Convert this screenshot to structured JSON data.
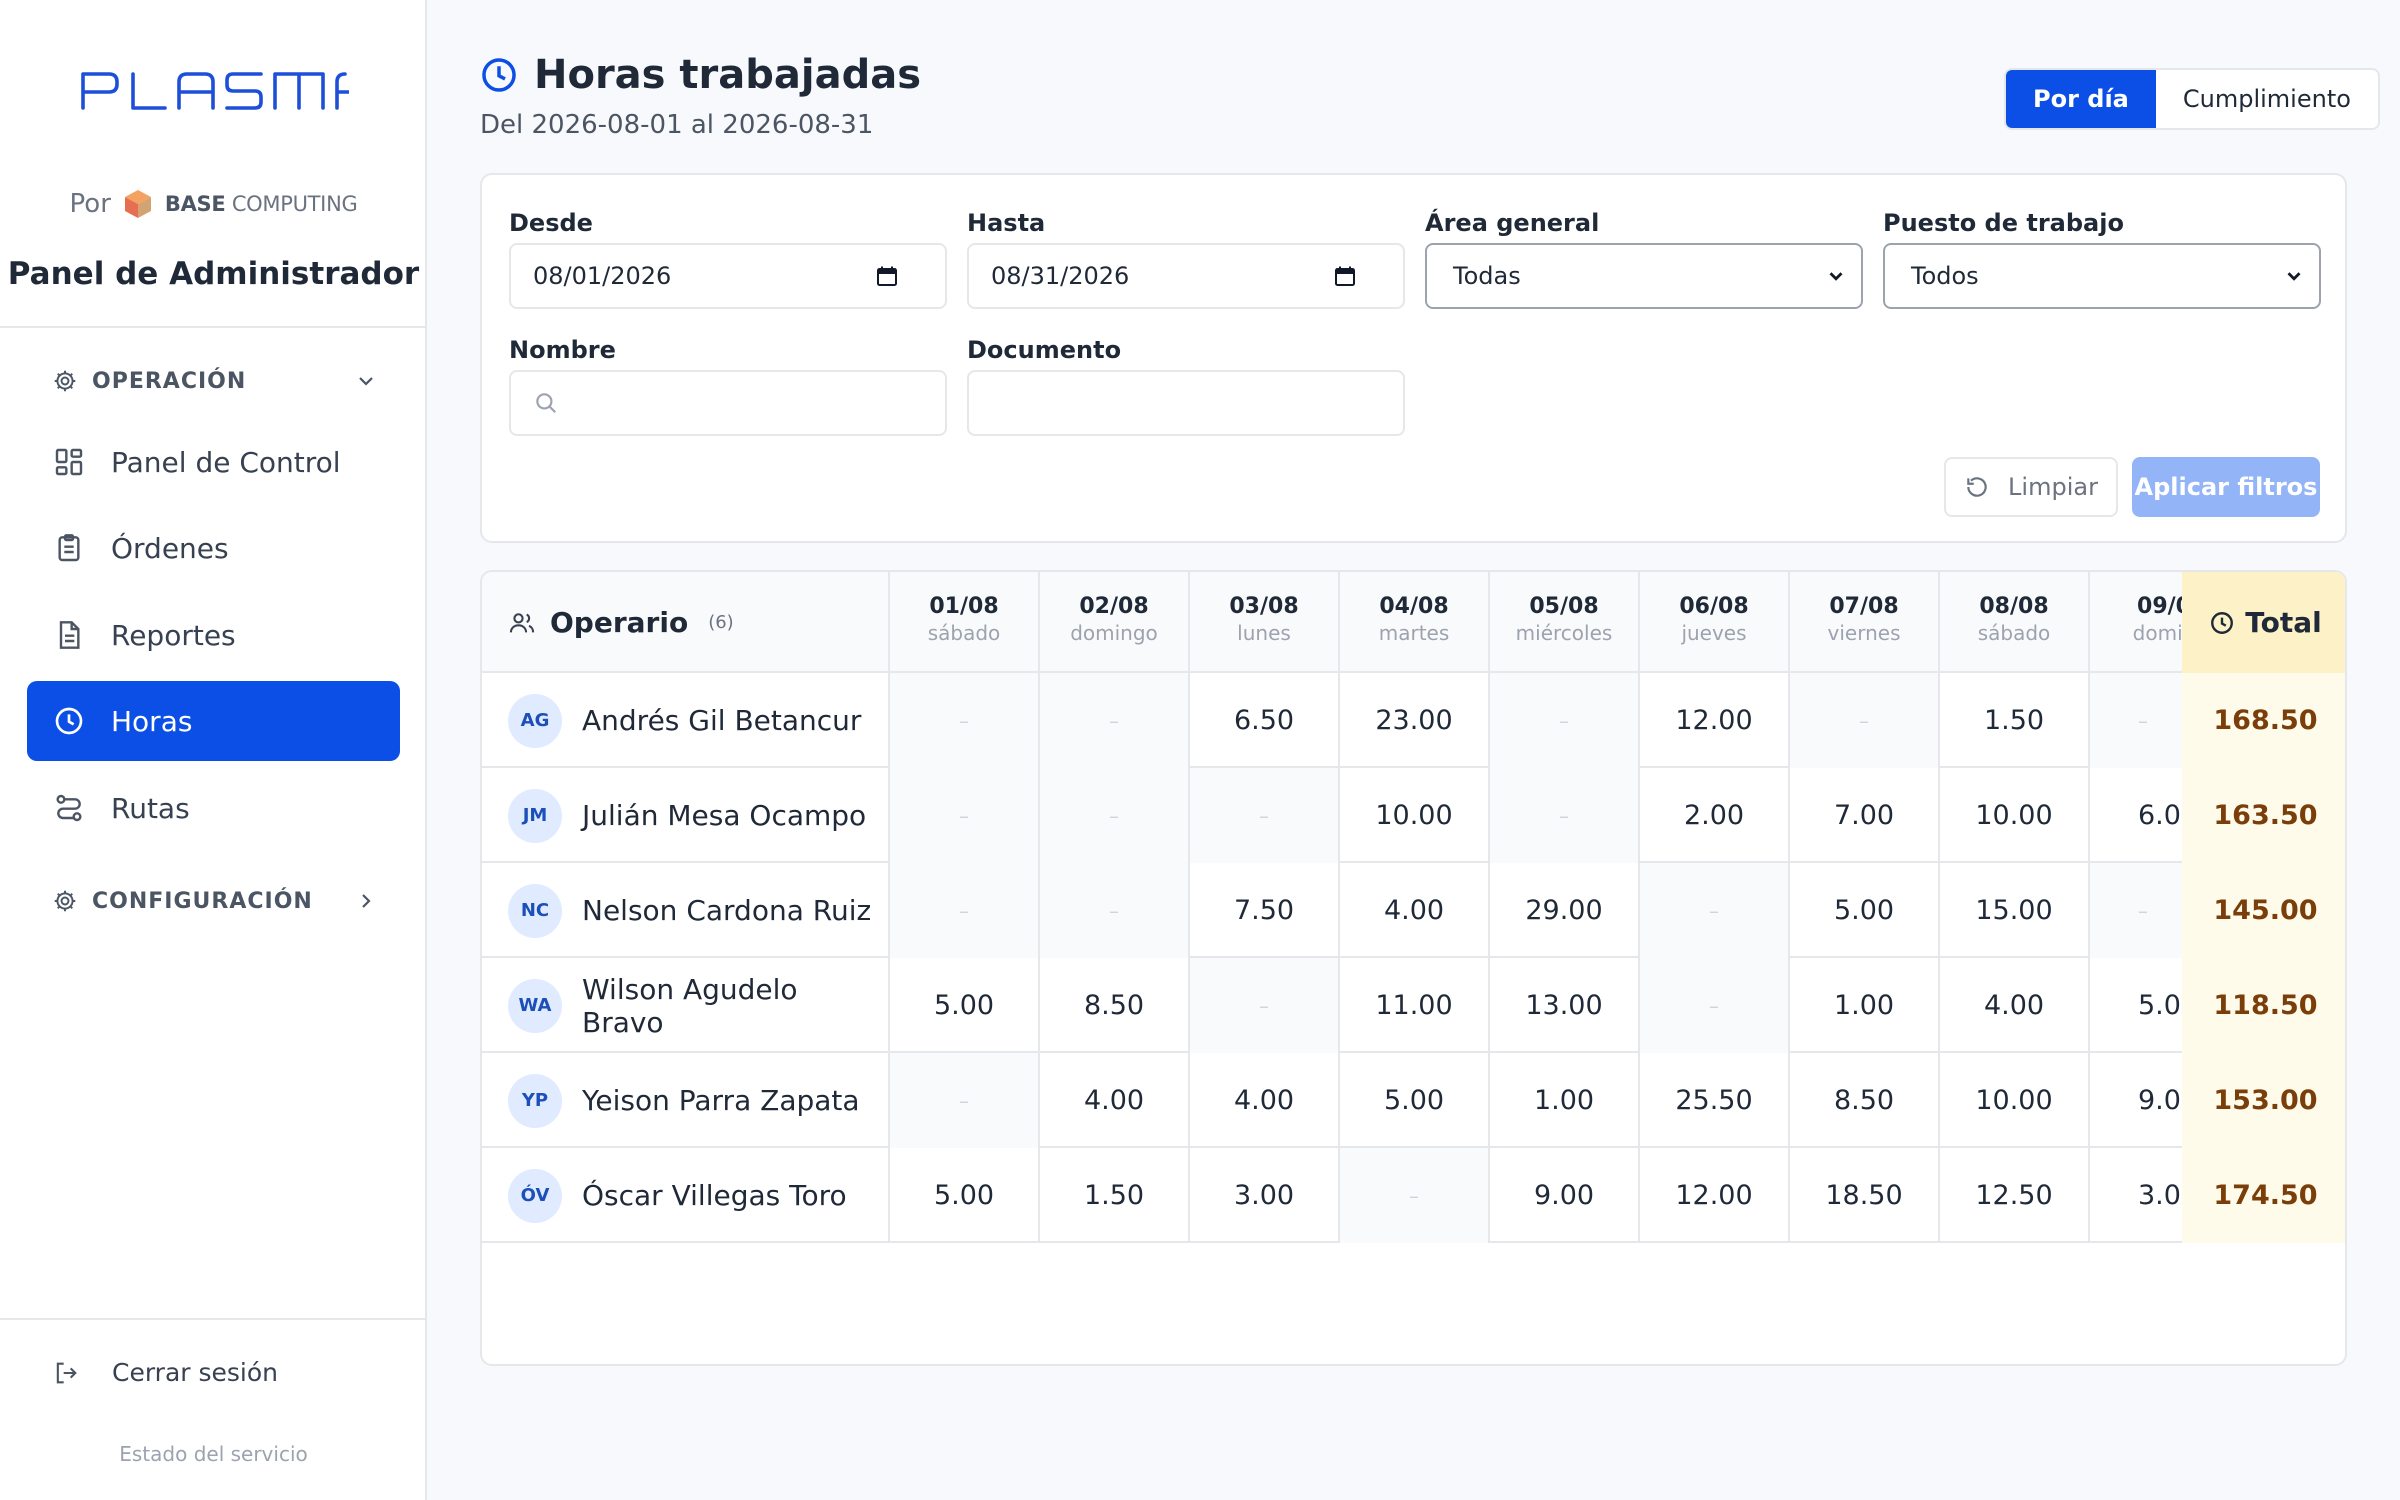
{
  "sidebar": {
    "logo_text": "PLASMA",
    "por": "Por",
    "brand_bold": "BASE",
    "brand_rest": "COMPUTING",
    "panel_title": "Panel de Administrador",
    "section_operacion": "OPERACIÓN",
    "section_configuracion": "CONFIGURACIÓN",
    "items": [
      {
        "label": "Panel de Control",
        "icon": "dashboard-icon"
      },
      {
        "label": "Órdenes",
        "icon": "clipboard-icon"
      },
      {
        "label": "Reportes",
        "icon": "document-icon"
      },
      {
        "label": "Horas",
        "icon": "clock-icon",
        "active": true
      },
      {
        "label": "Rutas",
        "icon": "route-icon"
      }
    ],
    "logout": "Cerrar sesión",
    "estado": "Estado del servicio"
  },
  "header": {
    "title": "Horas trabajadas",
    "subtitle": "Del 2026-08-01 al 2026-08-31",
    "toggle": [
      "Por día",
      "Cumplimiento"
    ]
  },
  "filters": {
    "desde_label": "Desde",
    "desde_value": "08/01/2026",
    "hasta_label": "Hasta",
    "hasta_value": "08/31/2026",
    "area_label": "Área general",
    "area_value": "Todas",
    "puesto_label": "Puesto de trabajo",
    "puesto_value": "Todos",
    "nombre_label": "Nombre",
    "nombre_value": "",
    "documento_label": "Documento",
    "documento_value": "",
    "clear_label": "Limpiar",
    "apply_label": "Aplicar filtros"
  },
  "table": {
    "operario_label": "Operario",
    "count": "(6)",
    "total_label": "Total",
    "empty_mark": "–",
    "days": [
      {
        "d": "01/08",
        "w": "sábado"
      },
      {
        "d": "02/08",
        "w": "domingo"
      },
      {
        "d": "03/08",
        "w": "lunes"
      },
      {
        "d": "04/08",
        "w": "martes"
      },
      {
        "d": "05/08",
        "w": "miércoles"
      },
      {
        "d": "06/08",
        "w": "jueves"
      },
      {
        "d": "07/08",
        "w": "viernes"
      },
      {
        "d": "08/08",
        "w": "sábado"
      },
      {
        "d": "09/0",
        "w": "domin"
      }
    ],
    "rows": [
      {
        "initials": "AG",
        "name": "Andrés Gil Betancur",
        "values": [
          "",
          "",
          "6.50",
          "23.00",
          "",
          "12.00",
          "",
          "1.50",
          ""
        ],
        "total": "168.50"
      },
      {
        "initials": "JM",
        "name": "Julián Mesa Ocampo",
        "values": [
          "",
          "",
          "",
          "10.00",
          "",
          "2.00",
          "7.00",
          "10.00",
          "6.0("
        ],
        "total": "163.50"
      },
      {
        "initials": "NC",
        "name": "Nelson Cardona Ruiz",
        "values": [
          "",
          "",
          "7.50",
          "4.00",
          "29.00",
          "",
          "5.00",
          "15.00",
          ""
        ],
        "total": "145.00"
      },
      {
        "initials": "WA",
        "name": "Wilson Agudelo Bravo",
        "values": [
          "5.00",
          "8.50",
          "",
          "11.00",
          "13.00",
          "",
          "1.00",
          "4.00",
          "5.0("
        ],
        "total": "118.50"
      },
      {
        "initials": "YP",
        "name": "Yeison Parra Zapata",
        "values": [
          "",
          "4.00",
          "4.00",
          "5.00",
          "1.00",
          "25.50",
          "8.50",
          "10.00",
          "9.0("
        ],
        "total": "153.00"
      },
      {
        "initials": "ÓV",
        "name": "Óscar Villegas Toro",
        "values": [
          "5.00",
          "1.50",
          "3.00",
          "",
          "9.00",
          "12.00",
          "18.50",
          "12.50",
          "3.0("
        ],
        "total": "174.50"
      }
    ]
  },
  "colors": {
    "accent": "#0b4fe6",
    "total_bg": "#fdf1c7",
    "total_text": "#7a3e0a"
  }
}
